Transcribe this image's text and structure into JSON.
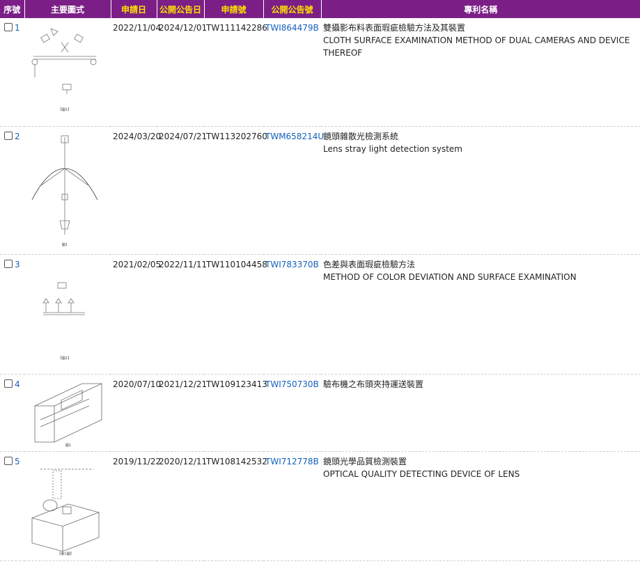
{
  "headers": {
    "seq": "序號",
    "figure": "主要圖式",
    "app_date": "申請日",
    "pub_date": "公開公告日",
    "app_no": "申請號",
    "pub_no": "公開公告號",
    "title": "專利名稱"
  },
  "rows": [
    {
      "seq": "1",
      "app_date": "2022/11/04",
      "pub_date": "2024/12/01",
      "app_no": "TW111142286",
      "pub_no": "TWI864479B",
      "title_zh": "雙攝影布料表面瑕疵檢驗方法及其裝置",
      "title_en": "CLOTH SURFACE EXAMINATION METHOD OF DUAL CAMERAS AND DEVICE THEREOF",
      "figure_caption": "【圖1】"
    },
    {
      "seq": "2",
      "app_date": "2024/03/20",
      "pub_date": "2024/07/21",
      "app_no": "TW113202760",
      "pub_no": "TWM658214U",
      "title_zh": "鏡頭雜散光檢測系統",
      "title_en": "Lens stray light detection system",
      "figure_caption": "圖1"
    },
    {
      "seq": "3",
      "app_date": "2021/02/05",
      "pub_date": "2022/11/11",
      "app_no": "TW110104458",
      "pub_no": "TWI783370B",
      "title_zh": "色差與表面瑕疵檢驗方法",
      "title_en": "METHOD OF COLOR DEVIATION AND SURFACE EXAMINATION",
      "figure_caption": "【圖1】"
    },
    {
      "seq": "4",
      "app_date": "2020/07/10",
      "pub_date": "2021/12/21",
      "app_no": "TW109123413",
      "pub_no": "TWI750730B",
      "title_zh": "驗布機之布頭夾持運送裝置",
      "title_en": "",
      "figure_caption": "圖1"
    },
    {
      "seq": "5",
      "app_date": "2019/11/22",
      "pub_date": "2020/12/11",
      "app_no": "TW108142532",
      "pub_no": "TWI712778B",
      "title_zh": "鏡頭光學品質檢測裝置",
      "title_en": "OPTICAL QUALITY DETECTING DEVICE OF LENS",
      "figure_caption": "【第1圖】"
    }
  ],
  "colors": {
    "header_bg": "#7b1f86",
    "header_text": "#ffffff",
    "header_highlight": "#ffe000",
    "link": "#1560bd"
  }
}
